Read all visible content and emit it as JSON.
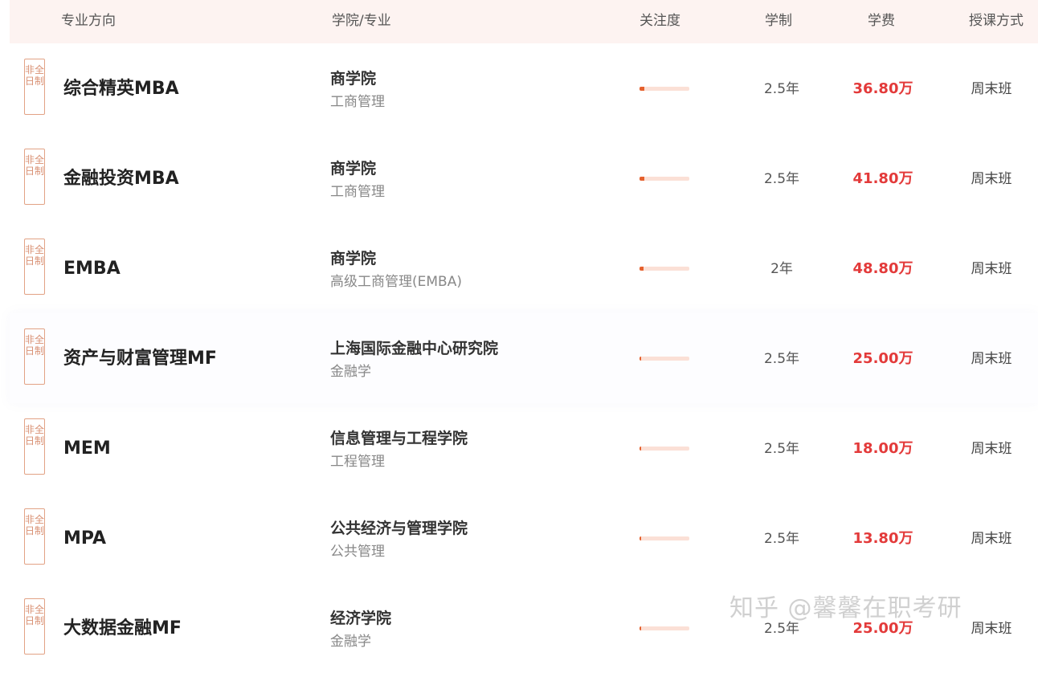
{
  "header": {
    "major": "专业方向",
    "school": "学院/专业",
    "attention": "关注度",
    "years": "学制",
    "fee": "学费",
    "mode": "授课方式"
  },
  "rows": [
    {
      "tag": "非全日制",
      "major": "综合精英MBA",
      "school": "商学院",
      "program": "工商管理",
      "attention": 0.1,
      "years": "2.5年",
      "fee": "36.80万",
      "mode": "周末班"
    },
    {
      "tag": "非全日制",
      "major": "金融投资MBA",
      "school": "商学院",
      "program": "工商管理",
      "attention": 0.1,
      "years": "2.5年",
      "fee": "41.80万",
      "mode": "周末班"
    },
    {
      "tag": "非全日制",
      "major": "EMBA",
      "school": "商学院",
      "program": "高级工商管理(EMBA)",
      "attention": 0.08,
      "years": "2年",
      "fee": "48.80万",
      "mode": "周末班"
    },
    {
      "tag": "非全日制",
      "major": "资产与财富管理MF",
      "school": "上海国际金融中心研究院",
      "program": "金融学",
      "attention": 0.03,
      "years": "2.5年",
      "fee": "25.00万",
      "mode": "周末班"
    },
    {
      "tag": "非全日制",
      "major": "MEM",
      "school": "信息管理与工程学院",
      "program": "工程管理",
      "attention": 0.03,
      "years": "2.5年",
      "fee": "18.00万",
      "mode": "周末班"
    },
    {
      "tag": "非全日制",
      "major": "MPA",
      "school": "公共经济与管理学院",
      "program": "公共管理",
      "attention": 0.03,
      "years": "2.5年",
      "fee": "13.80万",
      "mode": "周末班"
    },
    {
      "tag": "非全日制",
      "major": "大数据金融MF",
      "school": "经济学院",
      "program": "金融学",
      "attention": 0.03,
      "years": "2.5年",
      "fee": "25.00万",
      "mode": "周末班"
    }
  ],
  "watermark": "知乎 @馨馨在职考研"
}
